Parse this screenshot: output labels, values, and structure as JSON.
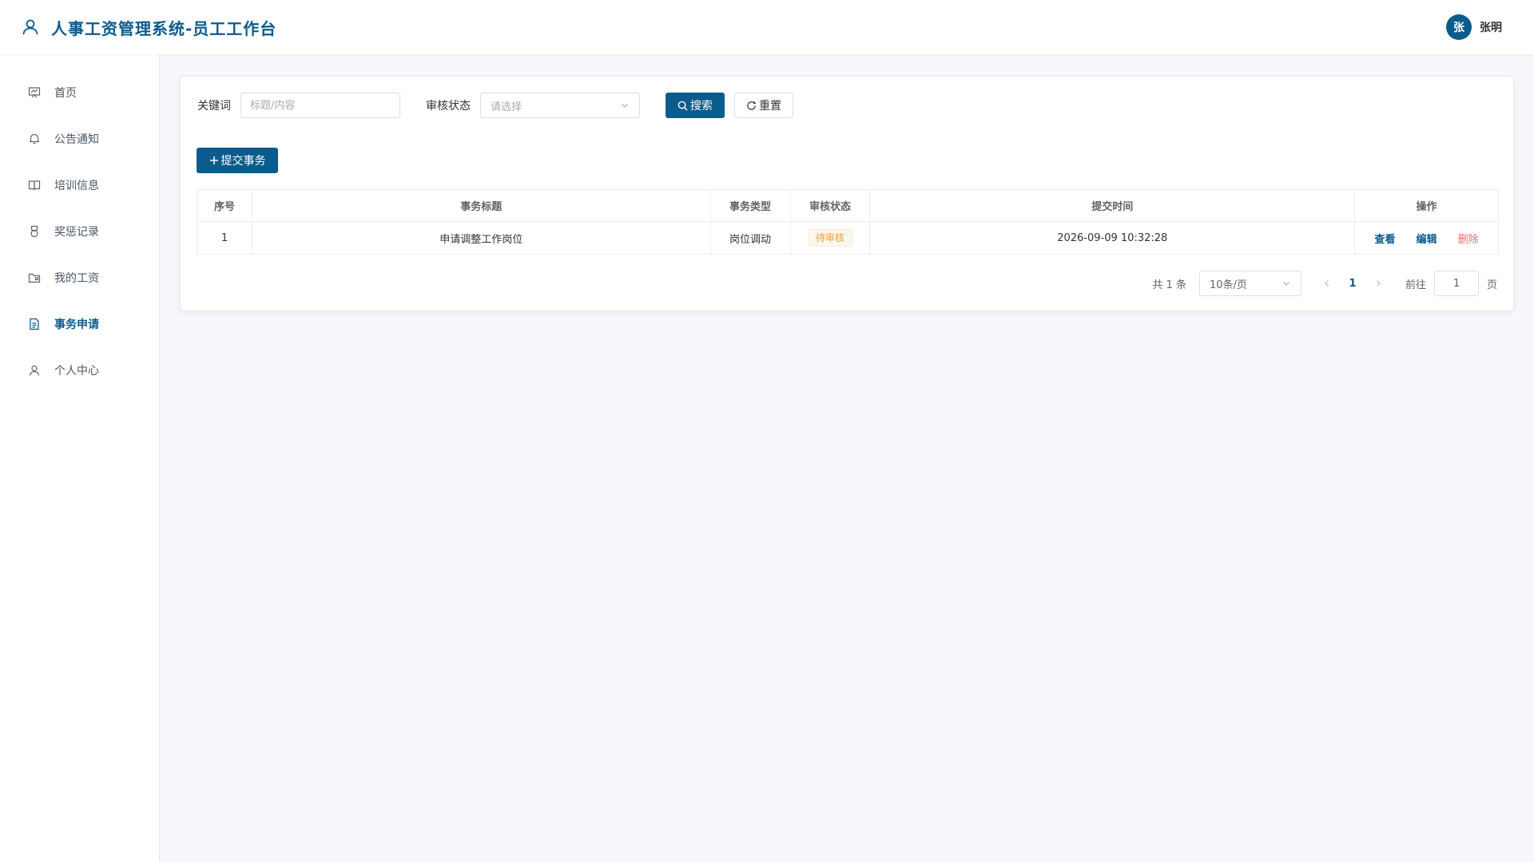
{
  "header": {
    "title": "人事工资管理系统-员工工作台",
    "user_avatar_text": "张",
    "user_name": "张明"
  },
  "sidebar": {
    "items": [
      {
        "label": "首页",
        "icon": "home-icon",
        "active": false
      },
      {
        "label": "公告通知",
        "icon": "bell-icon",
        "active": false
      },
      {
        "label": "培训信息",
        "icon": "book-icon",
        "active": false
      },
      {
        "label": "奖惩记录",
        "icon": "medal-icon",
        "active": false
      },
      {
        "label": "我的工资",
        "icon": "wallet-icon",
        "active": false
      },
      {
        "label": "事务申请",
        "icon": "document-icon",
        "active": true
      },
      {
        "label": "个人中心",
        "icon": "user-icon",
        "active": false
      }
    ]
  },
  "filter": {
    "keyword_label": "关键词",
    "keyword_placeholder": "标题/内容",
    "keyword_value": "",
    "status_label": "审核状态",
    "status_placeholder": "请选择",
    "search_label": "搜索",
    "reset_label": "重置"
  },
  "toolbar": {
    "add_label": "提交事务"
  },
  "table": {
    "columns": [
      "序号",
      "事务标题",
      "事务类型",
      "审核状态",
      "提交时间",
      "操作"
    ],
    "rows": [
      {
        "index": "1",
        "title": "申请调整工作岗位",
        "type": "岗位调动",
        "status": "待审核",
        "submitted": "2026-09-09 10:32:28",
        "actions": {
          "view": "查看",
          "edit": "编辑",
          "delete": "删除"
        }
      }
    ]
  },
  "pagination": {
    "total_text": "共 1 条",
    "page_size": "10条/页",
    "current_page": "1",
    "goto_label": "前往",
    "goto_value": "1",
    "page_unit": "页"
  },
  "colors": {
    "primary": "#0b5b8c",
    "danger": "#f56c6c",
    "warning": "#e6a23c",
    "background": "#f6f8fb"
  }
}
